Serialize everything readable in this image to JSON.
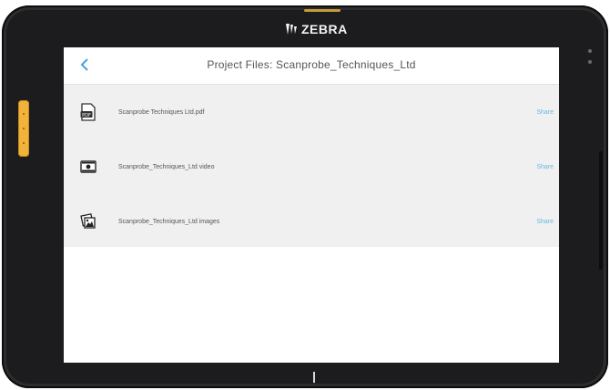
{
  "device": {
    "brand": "ZEBRA"
  },
  "header": {
    "back_label": "‹",
    "title": "Project Files: Scanprobe_Techniques_Ltd"
  },
  "files": [
    {
      "name": "Scanprobe Techniques Ltd.pdf",
      "icon": "pdf-file-icon",
      "action": "Share"
    },
    {
      "name": "Scanprobe_Techniques_Ltd video",
      "icon": "video-file-icon",
      "action": "Share"
    },
    {
      "name": "Scanprobe_Techniques_Ltd images",
      "icon": "image-file-icon",
      "action": "Share"
    }
  ],
  "colors": {
    "accent": "#4ba3d9",
    "list_bg": "#f0f0f0",
    "bezel": "#1c1c1e",
    "side_button": "#f2b33a"
  }
}
